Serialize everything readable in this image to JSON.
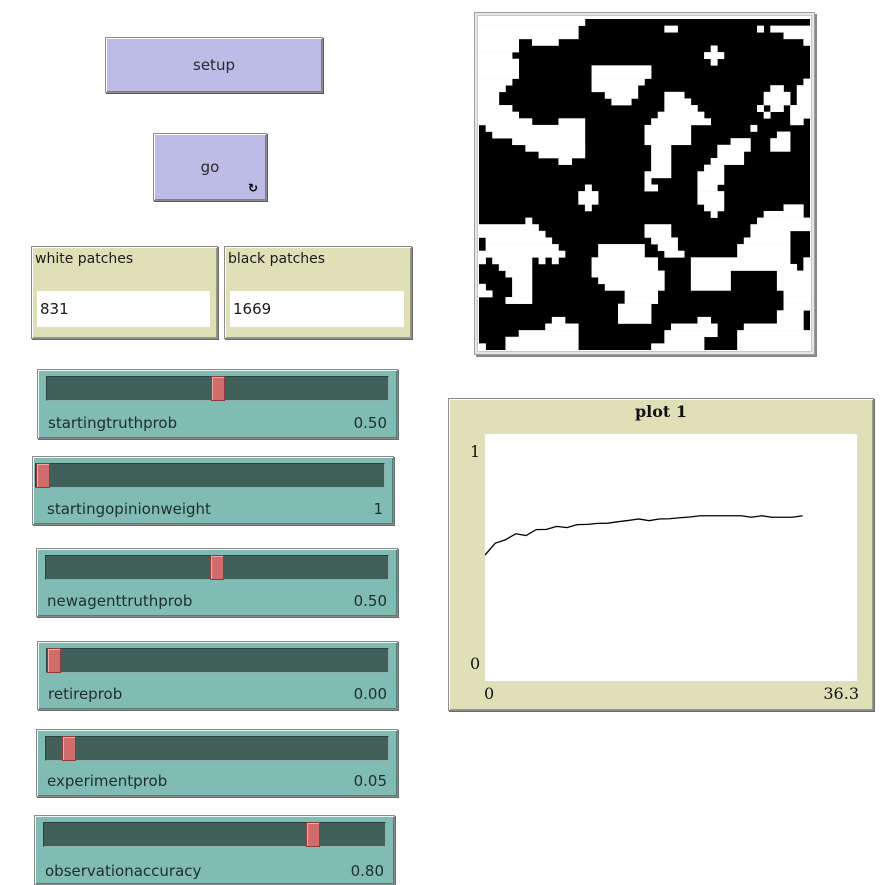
{
  "buttons": {
    "setup": {
      "label": "setup"
    },
    "go": {
      "label": "go",
      "forever": true,
      "icon": "forever-loop-icon"
    }
  },
  "monitors": [
    {
      "label": "white patches",
      "value": "831"
    },
    {
      "label": "black patches",
      "value": "1669"
    }
  ],
  "sliders": [
    {
      "name": "startingtruthprob",
      "value_text": "0.50",
      "fraction": 0.5
    },
    {
      "name": "startingopinionweight",
      "value_text": "1",
      "fraction": 0.0
    },
    {
      "name": "newagenttruthprob",
      "value_text": "0.50",
      "fraction": 0.5
    },
    {
      "name": "retireprob",
      "value_text": "0.00",
      "fraction": 0.0
    },
    {
      "name": "experimentprob",
      "value_text": "0.05",
      "fraction": 0.05
    },
    {
      "name": "observationaccuracy",
      "value_text": "0.80",
      "fraction": 0.8
    }
  ],
  "world": {
    "grid_size": [
      50,
      50
    ],
    "colors": {
      "on": "#000000",
      "off": "#ffffff"
    },
    "white_runs": [
      [
        [
          0,
          15
        ]
      ],
      [
        [
          0,
          14
        ],
        [
          28,
          29
        ],
        [
          42,
          42
        ],
        [
          44,
          49
        ]
      ],
      [
        [
          0,
          14
        ],
        [
          46,
          49
        ]
      ],
      [
        [
          0,
          5
        ],
        [
          8,
          11
        ],
        [
          49,
          49
        ]
      ],
      [
        [
          0,
          5
        ],
        [
          35,
          35
        ]
      ],
      [
        [
          0,
          4
        ],
        [
          34,
          36
        ]
      ],
      [
        [
          0,
          5
        ],
        [
          35,
          35
        ]
      ],
      [
        [
          0,
          5
        ],
        [
          17,
          24
        ],
        [
          25,
          25
        ]
      ],
      [
        [
          0,
          5
        ],
        [
          17,
          24
        ],
        [
          25,
          25
        ]
      ],
      [
        [
          0,
          4
        ],
        [
          17,
          24
        ],
        [
          49,
          49
        ]
      ],
      [
        [
          0,
          3
        ],
        [
          17,
          23
        ],
        [
          44,
          45
        ],
        [
          48,
          49
        ]
      ],
      [
        [
          0,
          2
        ],
        [
          19,
          23
        ],
        [
          28,
          30
        ],
        [
          43,
          46
        ],
        [
          48,
          49
        ]
      ],
      [
        [
          0,
          2
        ],
        [
          20,
          22
        ],
        [
          28,
          31
        ],
        [
          43,
          46
        ],
        [
          48,
          49
        ]
      ],
      [
        [
          0,
          4
        ],
        [
          28,
          32
        ],
        [
          42,
          42
        ],
        [
          44,
          45
        ],
        [
          47,
          49
        ]
      ],
      [
        [
          0,
          5
        ],
        [
          27,
          33
        ],
        [
          43,
          43
        ],
        [
          47,
          49
        ]
      ],
      [
        [
          0,
          7
        ],
        [
          12,
          15
        ],
        [
          26,
          34
        ],
        [
          47,
          48
        ]
      ],
      [
        [
          1,
          15
        ],
        [
          25,
          31
        ],
        [
          41,
          41
        ]
      ],
      [
        [
          2,
          15
        ],
        [
          25,
          31
        ],
        [
          45,
          46
        ]
      ],
      [
        [
          5,
          15
        ],
        [
          25,
          31
        ],
        [
          38,
          40
        ],
        [
          44,
          46
        ]
      ],
      [
        [
          7,
          15
        ],
        [
          26,
          28
        ],
        [
          36,
          40
        ],
        [
          44,
          46
        ]
      ],
      [
        [
          9,
          15
        ],
        [
          26,
          28
        ],
        [
          36,
          39
        ]
      ],
      [
        [
          12,
          13
        ],
        [
          26,
          28
        ],
        [
          35,
          39
        ]
      ],
      [
        [
          26,
          28
        ],
        [
          34,
          36
        ]
      ],
      [
        [
          25,
          28
        ],
        [
          33,
          36
        ]
      ],
      [
        [
          25,
          25
        ],
        [
          33,
          36
        ]
      ],
      [
        [
          16,
          16
        ],
        [
          25,
          26
        ],
        [
          33,
          35
        ]
      ],
      [
        [
          15,
          17
        ],
        [
          33,
          36
        ]
      ],
      [
        [
          15,
          17
        ],
        [
          33,
          36
        ]
      ],
      [
        [
          16,
          16
        ],
        [
          34,
          36
        ],
        [
          46,
          48
        ]
      ],
      [
        [
          35,
          35
        ],
        [
          43,
          48
        ]
      ],
      [
        [
          7,
          7
        ],
        [
          42,
          49
        ]
      ],
      [
        [
          0,
          8
        ],
        [
          25,
          28
        ],
        [
          41,
          49
        ]
      ],
      [
        [
          0,
          9
        ],
        [
          25,
          28
        ],
        [
          41,
          46
        ]
      ],
      [
        [
          1,
          10
        ],
        [
          26,
          29
        ],
        [
          40,
          46
        ]
      ],
      [
        [
          1,
          11
        ],
        [
          18,
          24
        ],
        [
          27,
          29
        ],
        [
          39,
          46
        ]
      ],
      [
        [
          0,
          12
        ],
        [
          18,
          24
        ],
        [
          28,
          30
        ],
        [
          39,
          46
        ]
      ],
      [
        [
          0,
          0
        ],
        [
          2,
          7
        ],
        [
          9,
          9
        ],
        [
          11,
          11
        ],
        [
          17,
          26
        ],
        [
          32,
          46
        ],
        [
          49,
          49
        ]
      ],
      [
        [
          3,
          7
        ],
        [
          17,
          26
        ],
        [
          32,
          47
        ],
        [
          49,
          49
        ]
      ],
      [
        [
          4,
          7
        ],
        [
          17,
          27
        ],
        [
          32,
          37
        ],
        [
          45,
          49
        ]
      ],
      [
        [
          5,
          7
        ],
        [
          18,
          27
        ],
        [
          32,
          37
        ],
        [
          45,
          49
        ]
      ],
      [
        [
          0,
          0
        ],
        [
          5,
          7
        ],
        [
          19,
          27
        ],
        [
          32,
          37
        ],
        [
          45,
          49
        ]
      ],
      [
        [
          0,
          1
        ],
        [
          5,
          7
        ],
        [
          22,
          26
        ],
        [
          46,
          49
        ]
      ],
      [
        [
          4,
          7
        ],
        [
          22,
          26
        ],
        [
          46,
          49
        ]
      ],
      [
        [
          21,
          25
        ],
        [
          46,
          49
        ]
      ],
      [
        [
          21,
          25
        ],
        [
          45,
          48
        ]
      ],
      [
        [
          11,
          12
        ],
        [
          21,
          25
        ],
        [
          33,
          34
        ],
        [
          45,
          48
        ]
      ],
      [
        [
          10,
          14
        ],
        [
          29,
          35
        ],
        [
          40,
          48
        ]
      ],
      [
        [
          6,
          14
        ],
        [
          28,
          35
        ],
        [
          39,
          49
        ]
      ],
      [
        [
          4,
          14
        ],
        [
          28,
          33
        ],
        [
          39,
          49
        ]
      ],
      [
        [
          0,
          0
        ],
        [
          4,
          14
        ],
        [
          26,
          33
        ],
        [
          39,
          49
        ]
      ]
    ]
  },
  "chart_data": {
    "type": "line",
    "title": "plot 1",
    "xlabel": "",
    "ylabel": "",
    "xlim": [
      0,
      36.3
    ],
    "ylim": [
      0,
      1
    ],
    "x_tick_labels": [
      "0",
      "36.3"
    ],
    "y_tick_labels": [
      "0",
      "1"
    ],
    "grid": false,
    "series": [
      {
        "name": "default",
        "color": "#000000",
        "x": [
          0,
          1,
          2,
          3,
          4,
          5,
          6,
          7,
          8,
          9,
          10,
          11,
          12,
          13,
          14,
          15,
          16,
          17,
          18,
          19,
          20,
          21,
          22,
          23,
          24,
          25,
          26,
          27,
          28,
          29,
          30,
          31
        ],
        "values": [
          0.51,
          0.558,
          0.572,
          0.596,
          0.589,
          0.613,
          0.614,
          0.626,
          0.621,
          0.633,
          0.634,
          0.638,
          0.639,
          0.645,
          0.65,
          0.656,
          0.649,
          0.656,
          0.657,
          0.661,
          0.664,
          0.669,
          0.669,
          0.669,
          0.669,
          0.669,
          0.663,
          0.669,
          0.663,
          0.663,
          0.663,
          0.669
        ]
      }
    ]
  }
}
